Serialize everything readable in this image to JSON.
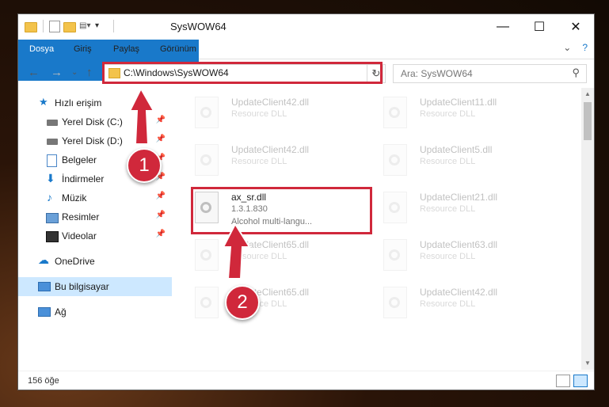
{
  "window": {
    "title": "SysWOW64"
  },
  "ribbon": {
    "tabs": [
      "Dosya",
      "Giriş",
      "Paylaş",
      "Görünüm"
    ]
  },
  "address": {
    "path": "C:\\Windows\\SysWOW64"
  },
  "search": {
    "placeholder": "Ara: SysWOW64"
  },
  "sidebar": {
    "items": [
      {
        "label": "Hızlı erişim"
      },
      {
        "label": "Yerel Disk (C:)"
      },
      {
        "label": "Yerel Disk (D:)"
      },
      {
        "label": "Belgeler"
      },
      {
        "label": "İndirmeler"
      },
      {
        "label": "Müzik"
      },
      {
        "label": "Resimler"
      },
      {
        "label": "Videolar"
      },
      {
        "label": "OneDrive"
      },
      {
        "label": "Bu bilgisayar"
      },
      {
        "label": "Ağ"
      }
    ]
  },
  "files": [
    {
      "name": "UpdateClient42.dll",
      "desc": "Resource DLL"
    },
    {
      "name": "UpdateClient11.dll",
      "desc": "Resource DLL"
    },
    {
      "name": "UpdateClient42.dll",
      "desc": "Resource DLL"
    },
    {
      "name": "UpdateClient5.dll",
      "desc": "Resource DLL"
    },
    {
      "name": "ax_sr.dll",
      "version": "1.3.1.830",
      "desc": "Alcohol multi-langu..."
    },
    {
      "name": "UpdateClient21.dll",
      "desc": "Resource DLL"
    },
    {
      "name": "UpdateClient65.dll",
      "desc": "Resource DLL"
    },
    {
      "name": "UpdateClient63.dll",
      "desc": "Resource DLL"
    },
    {
      "name": "UpdateClient65.dll",
      "desc": "Resource DLL"
    },
    {
      "name": "UpdateClient42.dll",
      "desc": "Resource DLL"
    }
  ],
  "status": {
    "count": "156 öğe"
  },
  "annotations": {
    "step1": "1",
    "step2": "2"
  },
  "colors": {
    "accent": "#1979ca",
    "highlight": "#d0283b",
    "selected": "#cde8ff"
  }
}
